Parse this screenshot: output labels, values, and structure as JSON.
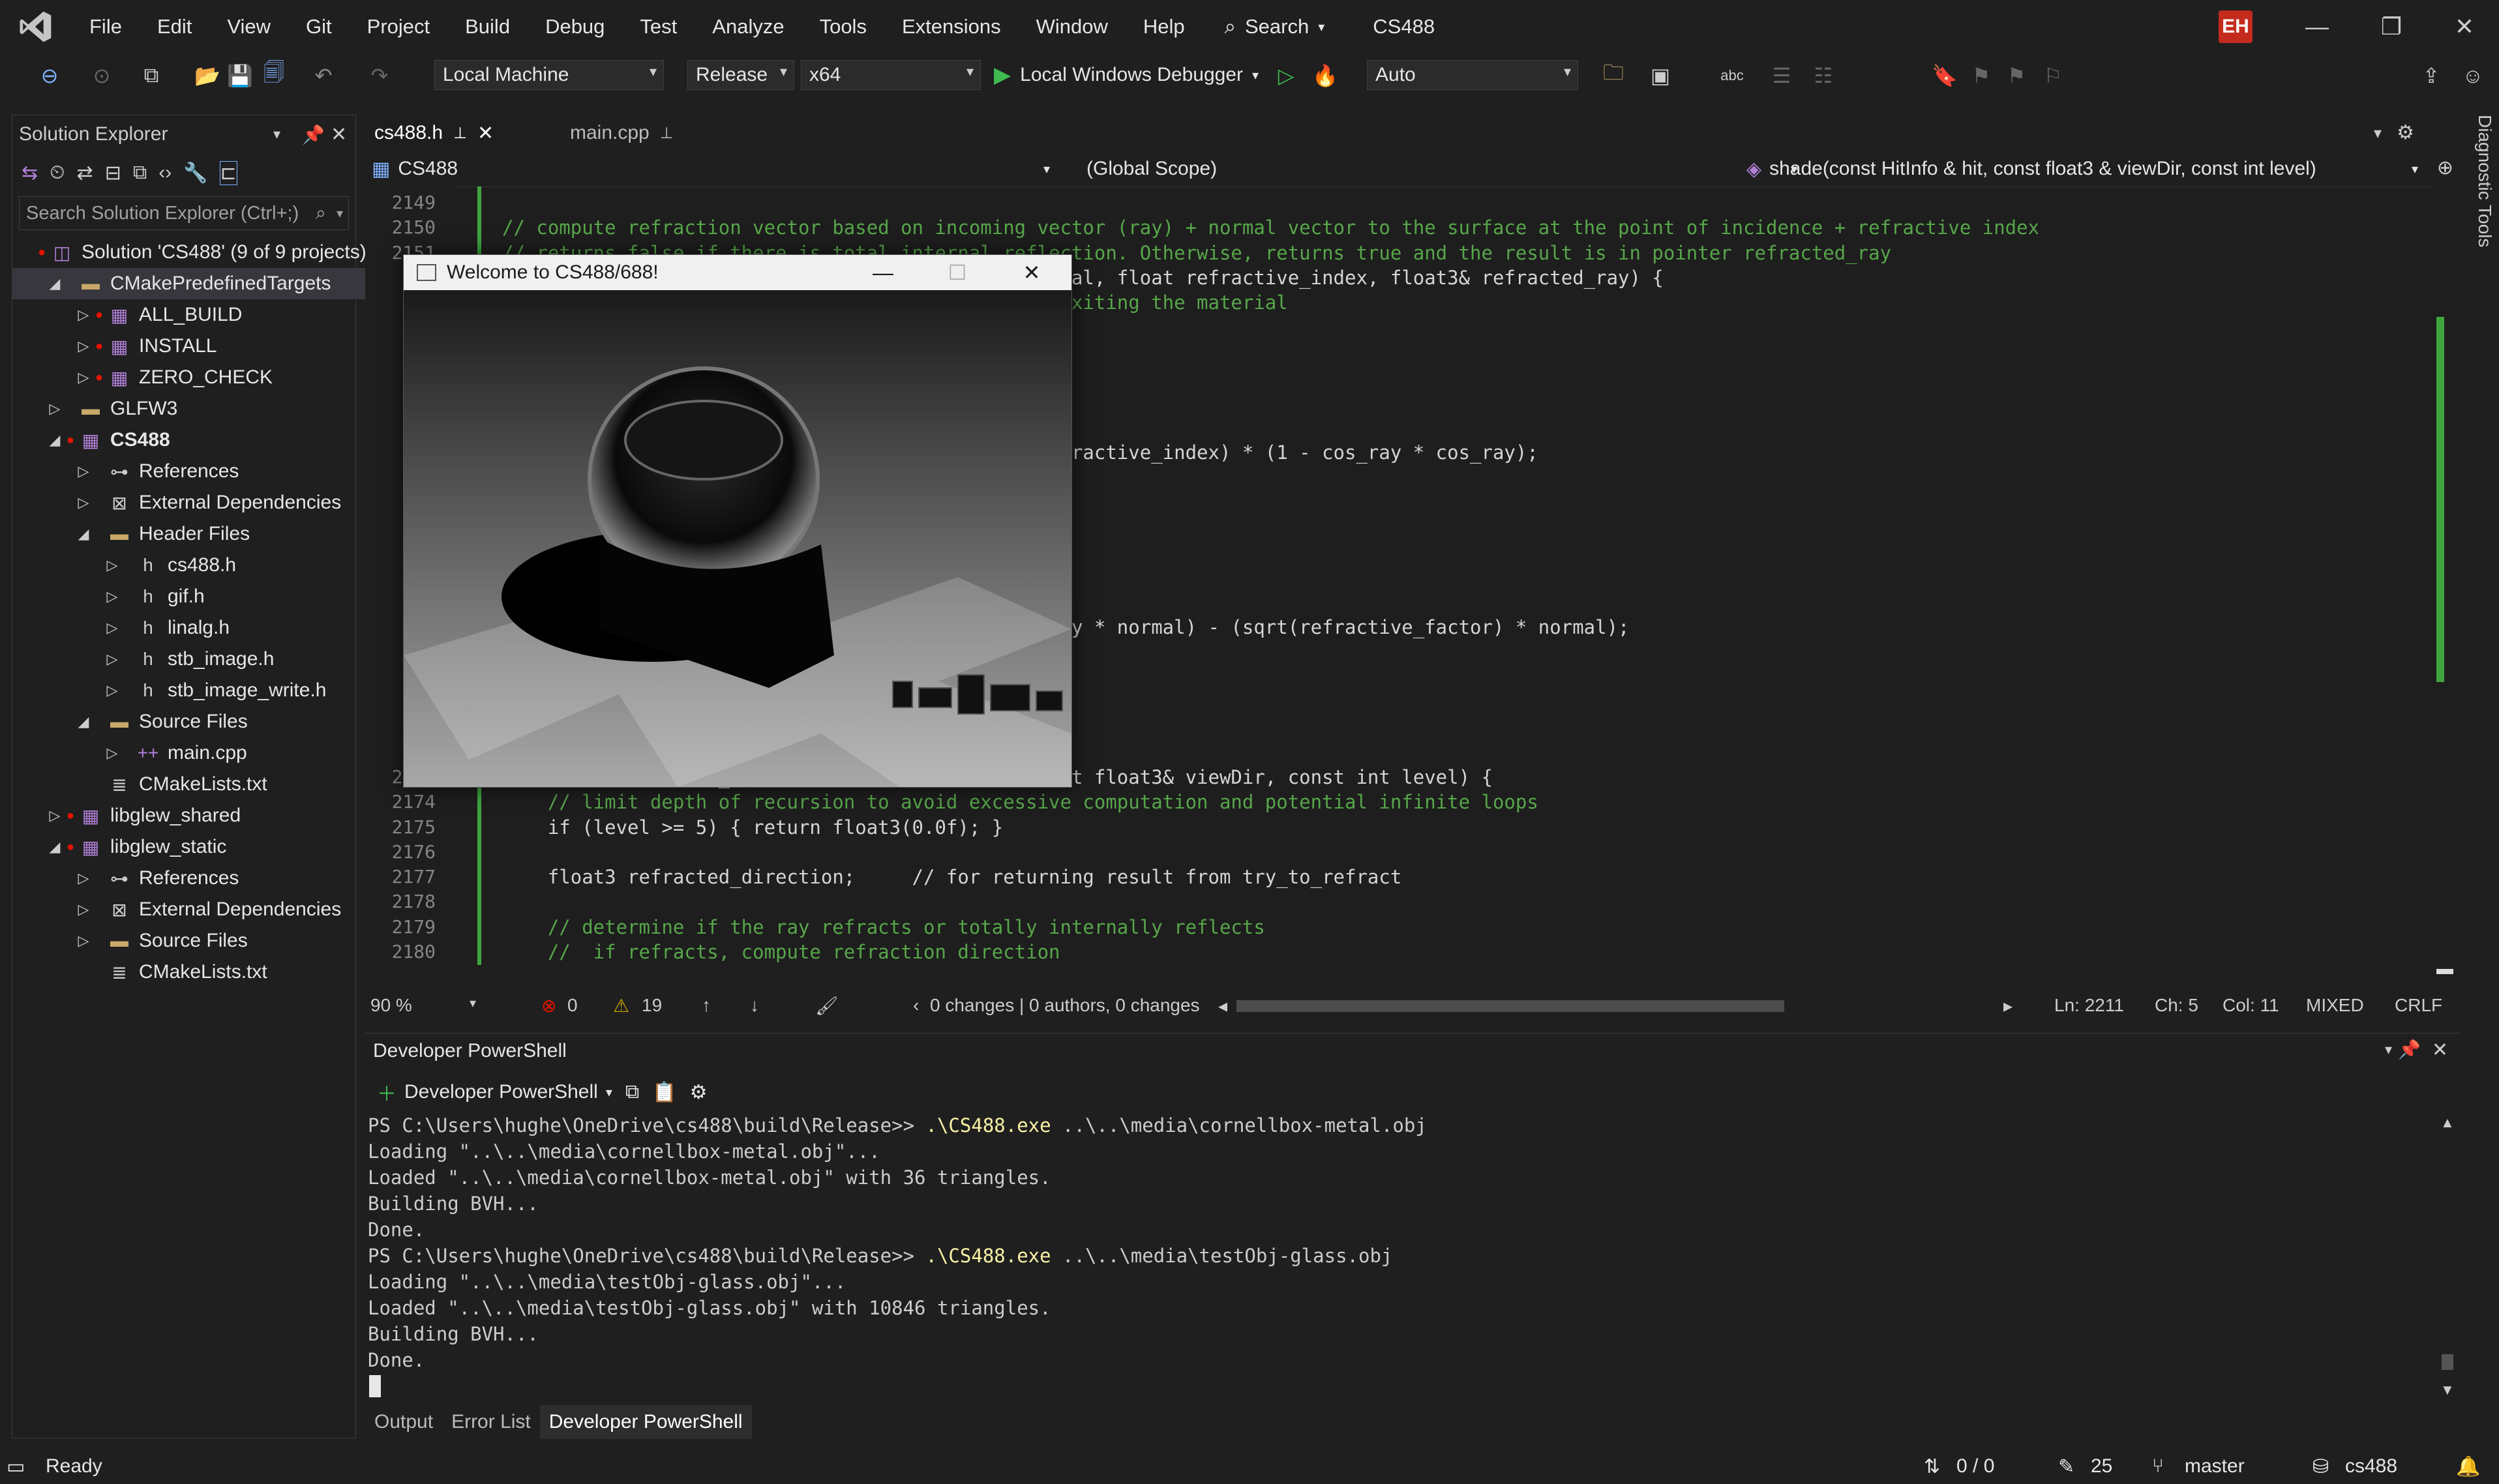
{
  "menubar": {
    "items": [
      "File",
      "Edit",
      "View",
      "Git",
      "Project",
      "Build",
      "Debug",
      "Test",
      "Analyze",
      "Tools",
      "Extensions",
      "Window",
      "Help"
    ],
    "search_label": "Search",
    "title": "CS488",
    "user_initials": "EH",
    "badge_color": "#c42b1c"
  },
  "toolbar": {
    "target_combo": "Local Machine",
    "config_combo": "Release",
    "platform_combo": "x64",
    "debugger_label": "Local Windows Debugger",
    "auto_combo": "Auto",
    "run_color": "#3fb950"
  },
  "solution_explorer": {
    "title": "Solution Explorer",
    "search_placeholder": "Search Solution Explorer (Ctrl+;)",
    "items": [
      {
        "label": "Solution 'CS488' (9 of 9 projects)",
        "level": 0,
        "icon": "solution-icon",
        "chevron": ""
      },
      {
        "label": "CMakePredefinedTargets",
        "level": 1,
        "icon": "folder-icon",
        "chevron": "expanded",
        "selected": true
      },
      {
        "label": "ALL_BUILD",
        "level": 2,
        "icon": "project-icon",
        "chevron": "collapsed"
      },
      {
        "label": "INSTALL",
        "level": 2,
        "icon": "project-icon",
        "chevron": "collapsed"
      },
      {
        "label": "ZERO_CHECK",
        "level": 2,
        "icon": "project-icon",
        "chevron": "collapsed"
      },
      {
        "label": "GLFW3",
        "level": 1,
        "icon": "folder-icon",
        "chevron": "collapsed"
      },
      {
        "label": "CS488",
        "level": 1,
        "icon": "project-icon",
        "chevron": "expanded",
        "bold": true
      },
      {
        "label": "References",
        "level": 2,
        "icon": "references-icon",
        "chevron": "collapsed"
      },
      {
        "label": "External Dependencies",
        "level": 2,
        "icon": "dependencies-icon",
        "chevron": "collapsed"
      },
      {
        "label": "Header Files",
        "level": 2,
        "icon": "filter-folder-icon",
        "chevron": "expanded"
      },
      {
        "label": "cs488.h",
        "level": 3,
        "icon": "header-file-icon",
        "chevron": "collapsed"
      },
      {
        "label": "gif.h",
        "level": 3,
        "icon": "header-file-icon",
        "chevron": "collapsed"
      },
      {
        "label": "linalg.h",
        "level": 3,
        "icon": "header-file-icon",
        "chevron": "collapsed"
      },
      {
        "label": "stb_image.h",
        "level": 3,
        "icon": "header-file-icon",
        "chevron": "collapsed"
      },
      {
        "label": "stb_image_write.h",
        "level": 3,
        "icon": "header-file-icon",
        "chevron": "collapsed"
      },
      {
        "label": "Source Files",
        "level": 2,
        "icon": "filter-folder-icon",
        "chevron": "expanded"
      },
      {
        "label": "main.cpp",
        "level": 3,
        "icon": "cpp-file-icon",
        "chevron": "collapsed"
      },
      {
        "label": "CMakeLists.txt",
        "level": 2,
        "icon": "text-file-icon",
        "chevron": ""
      },
      {
        "label": "libglew_shared",
        "level": 1,
        "icon": "project-icon",
        "chevron": "collapsed"
      },
      {
        "label": "libglew_static",
        "level": 1,
        "icon": "project-icon",
        "chevron": "expanded"
      },
      {
        "label": "References",
        "level": 2,
        "icon": "references-icon",
        "chevron": "collapsed"
      },
      {
        "label": "External Dependencies",
        "level": 2,
        "icon": "dependencies-icon",
        "chevron": "collapsed"
      },
      {
        "label": "Source Files",
        "level": 2,
        "icon": "filter-folder-icon",
        "chevron": "collapsed"
      },
      {
        "label": "CMakeLists.txt",
        "level": 2,
        "icon": "text-file-icon",
        "chevron": ""
      }
    ]
  },
  "editor": {
    "tabs": [
      {
        "label": "cs488.h",
        "active": true
      },
      {
        "label": "main.cpp",
        "active": false
      }
    ],
    "nav": {
      "project": "CS488",
      "scope": "(Global Scope)",
      "member": "shade(const HitInfo & hit, const float3 & viewDir, const int level)"
    },
    "lines": [
      {
        "n": "2149",
        "text": ""
      },
      {
        "n": "2150",
        "text": "// compute refraction vector based on incoming vector (ray) + normal vector to the surface at the point of incidence + refractive index",
        "cls": "c-com"
      },
      {
        "n": "2151",
        "text": "// returns false if there is total internal reflection. Otherwise, returns true and the result is in pointer refracted_ray",
        "cls": "c-com"
      },
      {
        "n": "",
        "text": "                                            3 normal, float refractive_index, float3& refracted_ray) {"
      },
      {
        "n": "",
        "text": "                                            y is exiting the material",
        "cls": "c-com"
      },
      {
        "n": "",
        "text": ""
      },
      {
        "n": "",
        "text": ""
      },
      {
        "n": "",
        "text": ""
      },
      {
        "n": "",
        "text": ""
      },
      {
        "n": "",
        "text": ""
      },
      {
        "n": "",
        "text": "                                             * refractive_index) * (1 - cos_ray * cos_ray);"
      },
      {
        "n": "",
        "text": ""
      },
      {
        "n": "",
        "text": ""
      },
      {
        "n": "",
        "text": ""
      },
      {
        "n": "",
        "text": ""
      },
      {
        "n": "",
        "text": ""
      },
      {
        "n": "",
        "text": ""
      },
      {
        "n": "",
        "text": "                                            cos_ray * normal) - (sqrt(refractive_factor) * normal);"
      },
      {
        "n": "",
        "text": ""
      },
      {
        "n": "",
        "text": ""
      },
      {
        "n": "",
        "text": ""
      },
      {
        "n": "",
        "text": ""
      },
      {
        "n": "",
        "text": ""
      },
      {
        "n": "2173",
        "text": "static float3 shade_glass(const HitInfo& hit, const float3& viewDir, const int level) {"
      },
      {
        "n": "2174",
        "text": "    // limit depth of recursion to avoid excessive computation and potential infinite loops",
        "cls": "c-com"
      },
      {
        "n": "2175",
        "text": "    if (level >= 5) { return float3(0.0f); }"
      },
      {
        "n": "2176",
        "text": ""
      },
      {
        "n": "2177",
        "text": "    float3 refracted_direction;     // for returning result from try_to_refract"
      },
      {
        "n": "2178",
        "text": ""
      },
      {
        "n": "2179",
        "text": "    // determine if the ray refracts or totally internally reflects",
        "cls": "c-com"
      },
      {
        "n": "2180",
        "text": "    //  if refracts, compute refraction direction",
        "cls": "c-com"
      }
    ],
    "status": {
      "zoom": "90 %",
      "errors": "0",
      "warnings": "19",
      "changes": "0 changes | 0 authors, 0 changes",
      "ln": "Ln: 2211",
      "ch": "Ch: 5",
      "col": "Col: 11",
      "mode": "MIXED",
      "eol": "CRLF"
    }
  },
  "floating_window": {
    "title": "Welcome to CS488/688!"
  },
  "terminal": {
    "title": "Developer PowerShell",
    "new_label": "Developer PowerShell",
    "lines": [
      {
        "prompt": "PS C:\\Users\\hughe\\OneDrive\\cs488\\build\\Release>> ",
        "cmd": ".\\CS488.exe",
        "args": " ..\\..\\media\\cornellbox-metal.obj"
      },
      {
        "text": "Loading \"..\\..\\media\\cornellbox-metal.obj\"..."
      },
      {
        "text": "Loaded \"..\\..\\media\\cornellbox-metal.obj\" with 36 triangles."
      },
      {
        "text": "Building BVH..."
      },
      {
        "text": "Done."
      },
      {
        "prompt": "PS C:\\Users\\hughe\\OneDrive\\cs488\\build\\Release>> ",
        "cmd": ".\\CS488.exe",
        "args": " ..\\..\\media\\testObj-glass.obj"
      },
      {
        "text": "Loading \"..\\..\\media\\testObj-glass.obj\"..."
      },
      {
        "text": "Loaded \"..\\..\\media\\testObj-glass.obj\" with 10846 triangles."
      },
      {
        "text": "Building BVH..."
      },
      {
        "text": "Done."
      }
    ],
    "bottom_tabs": [
      {
        "label": "Output",
        "active": false
      },
      {
        "label": "Error List",
        "active": false
      },
      {
        "label": "Developer PowerShell",
        "active": true
      }
    ]
  },
  "statusbar": {
    "state": "Ready",
    "git_sync": "0 / 0",
    "edits": "25",
    "branch": "master",
    "repo": "cs488",
    "diagnostic_tools": "Diagnostic Tools"
  }
}
